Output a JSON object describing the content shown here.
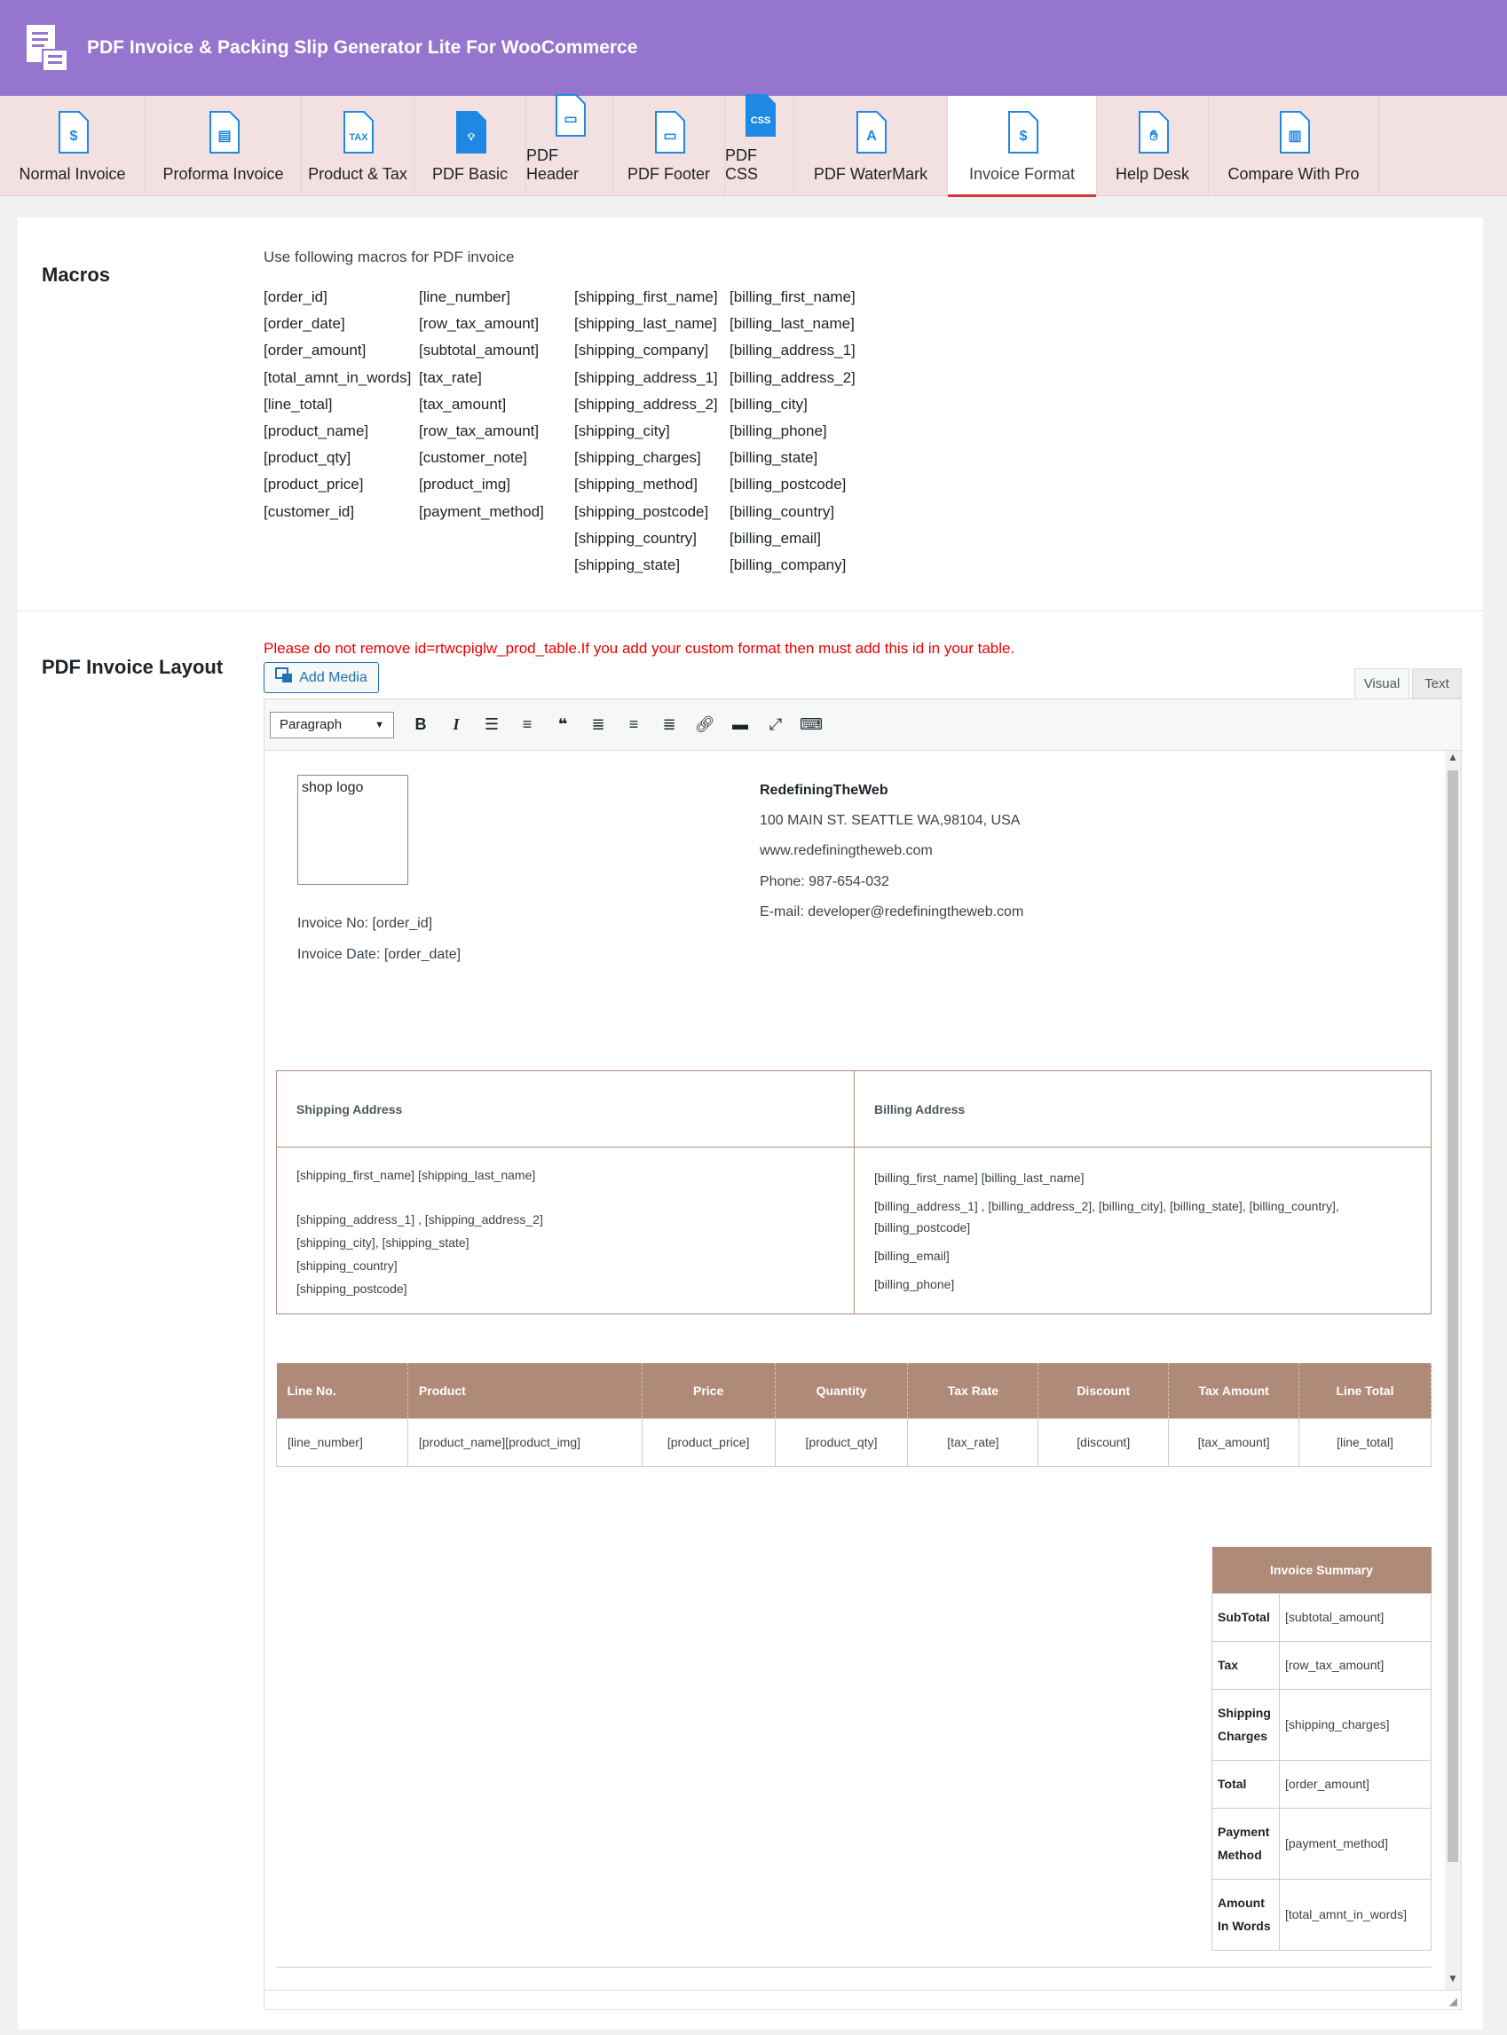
{
  "header": {
    "title": "PDF Invoice & Packing Slip Generator Lite For WooCommerce"
  },
  "tabs": [
    {
      "label": "Normal Invoice",
      "icon": "invoice-icon"
    },
    {
      "label": "Proforma Invoice",
      "icon": "proforma-invoice-icon"
    },
    {
      "label": "Product & Tax",
      "icon": "tax-icon"
    },
    {
      "label": "PDF Basic",
      "icon": "lightbulb-icon"
    },
    {
      "label": "PDF Header",
      "icon": "page-header-icon"
    },
    {
      "label": "PDF Footer",
      "icon": "page-footer-icon"
    },
    {
      "label": "PDF CSS",
      "icon": "css-file-icon"
    },
    {
      "label": "PDF WaterMark",
      "icon": "watermark-icon"
    },
    {
      "label": "Invoice Format",
      "icon": "invoice-format-icon",
      "active": true
    },
    {
      "label": "Help Desk",
      "icon": "help-hands-icon"
    },
    {
      "label": "Compare With Pro",
      "icon": "compare-chart-icon"
    }
  ],
  "macros": {
    "title": "Macros",
    "intro": "Use following macros for PDF invoice",
    "columns": [
      [
        "[order_id]",
        "[order_date]",
        "[order_amount]",
        "[total_amnt_in_words]",
        "[line_total]",
        "[product_name]",
        "[product_qty]",
        "[product_price]",
        "[customer_id]"
      ],
      [
        "[line_number]",
        "[row_tax_amount]",
        "[subtotal_amount]",
        "[tax_rate]",
        "[tax_amount]",
        "[row_tax_amount]",
        "[customer_note]",
        "[product_img]",
        "[payment_method]"
      ],
      [
        "[shipping_first_name]",
        "[shipping_last_name]",
        "[shipping_company]",
        "[shipping_address_1]",
        "[shipping_address_2]",
        "[shipping_city]",
        "[shipping_charges]",
        "[shipping_method]",
        "[shipping_postcode]",
        "[shipping_country]",
        "[shipping_state]"
      ],
      [
        "[billing_first_name]",
        "[billing_last_name]",
        "[billing_address_1]",
        "[billing_address_2]",
        "[billing_city]",
        "[billing_phone]",
        "[billing_state]",
        "[billing_postcode]",
        "[billing_country]",
        "[billing_email]",
        "[billing_company]"
      ]
    ]
  },
  "layout": {
    "title": "PDF Invoice Layout",
    "warning": "Please do not remove id=rtwcpiglw_prod_table.If you add your custom format then must add this id in your table.",
    "add_media": "Add Media",
    "visual_tab": "Visual",
    "text_tab": "Text",
    "format_select": "Paragraph"
  },
  "invoice": {
    "shop_logo": "shop logo",
    "invoice_no": "Invoice No: [order_id]",
    "invoice_date": "Invoice Date: [order_date]",
    "company_name": "RedefiningTheWeb",
    "company_address": "100 MAIN ST. SEATTLE WA,98104, USA",
    "company_site": "www.redefiningtheweb.com",
    "company_phone": "Phone: 987-654-032",
    "company_email": "E-mail: developer@redefiningtheweb.com",
    "shipping_heading": "Shipping Address",
    "billing_heading": "Billing Address",
    "shipping_name": "[shipping_first_name] [shipping_last_name]",
    "shipping_addr": "[shipping_address_1] , [shipping_address_2]",
    "shipping_city_state": "[shipping_city], [shipping_state]",
    "shipping_country": "[shipping_country]",
    "shipping_postcode": "[shipping_postcode]",
    "billing_name": "[billing_first_name] [billing_last_name]",
    "billing_addr": "[billing_address_1] , [billing_address_2], [billing_city], [billing_state], [billing_country], [billing_postcode]",
    "billing_email": "[billing_email]",
    "billing_phone": "[billing_phone]",
    "product_headers": [
      "Line No.",
      "Product",
      "Price",
      "Quantity",
      "Tax Rate",
      "Discount",
      "Tax Amount",
      "Line Total"
    ],
    "product_row": [
      "[line_number]",
      "[product_name][product_img]",
      "[product_price]",
      "[product_qty]",
      "[tax_rate]",
      "[discount]",
      "[tax_amount]",
      "[line_total]"
    ],
    "summary_heading": "Invoice Summary",
    "summary": [
      {
        "k": "SubTotal",
        "v": "[subtotal_amount]"
      },
      {
        "k": "Tax",
        "v": "[row_tax_amount]"
      },
      {
        "k": "Shipping Charges",
        "v": "[shipping_charges]"
      },
      {
        "k": "Total",
        "v": "[order_amount]"
      },
      {
        "k": "Payment Method",
        "v": "[payment_method]"
      },
      {
        "k": "Amount In Words",
        "v": "[total_amnt_in_words]"
      }
    ]
  }
}
